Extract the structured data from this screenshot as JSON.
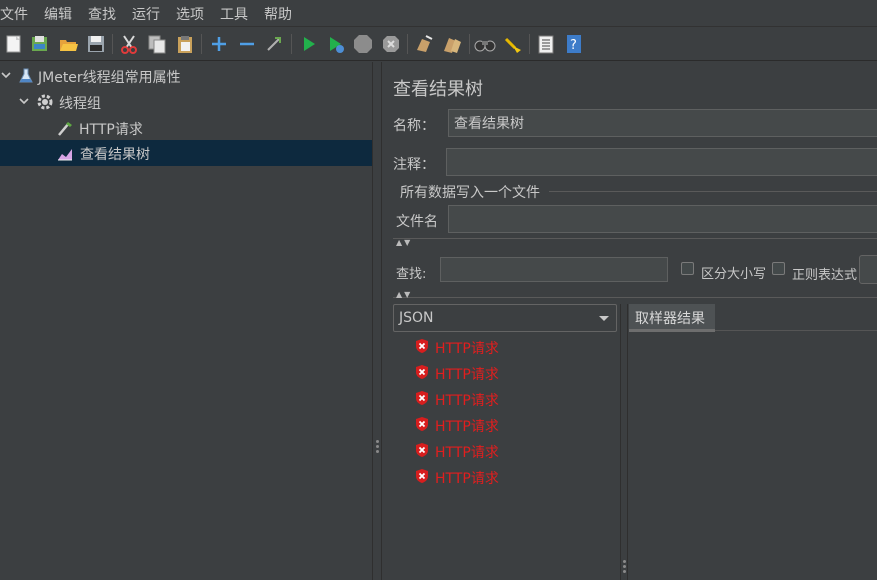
{
  "menu": [
    "文件",
    "编辑",
    "查找",
    "运行",
    "选项",
    "工具",
    "帮助"
  ],
  "toolbar": {
    "icons": [
      "new-file-icon",
      "template-icon",
      "open-icon",
      "save-icon",
      "cut-icon",
      "copy-icon",
      "paste-icon",
      "expand-icon",
      "collapse-icon",
      "toggle-icon",
      "start-icon",
      "start-no-pause-icon",
      "stop-icon",
      "shutdown-icon",
      "clear-icon",
      "clear-all-icon",
      "search-icon",
      "reset-search-icon",
      "function-helper-icon",
      "help-icon"
    ]
  },
  "tree": {
    "items": [
      {
        "label": "JMeter线程组常用属性",
        "icon": "test-plan-icon",
        "expanded": true
      },
      {
        "label": "线程组",
        "icon": "gear-icon",
        "expanded": true
      },
      {
        "label": "HTTP请求",
        "icon": "pipette-icon"
      },
      {
        "label": "查看结果树",
        "icon": "chart-icon",
        "selected": true
      }
    ]
  },
  "panel": {
    "title": "查看结果树",
    "name_label": "名称：",
    "name_value": "查看结果树",
    "comment_label": "注释：",
    "comment_value": "",
    "file_group_label": "所有数据写入一个文件",
    "filename_label": "文件名",
    "filename_value": "",
    "search_label": "查找:",
    "search_value": "",
    "case_sensitive_label": "区分大小写",
    "regex_label": "正则表达式",
    "renderer_selected": "JSON",
    "tab_label": "取样器结果",
    "results": [
      "HTTP请求",
      "HTTP请求",
      "HTTP请求",
      "HTTP请求",
      "HTTP请求",
      "HTTP请求"
    ],
    "result_status": "error",
    "error_color": "#e11e1e"
  }
}
